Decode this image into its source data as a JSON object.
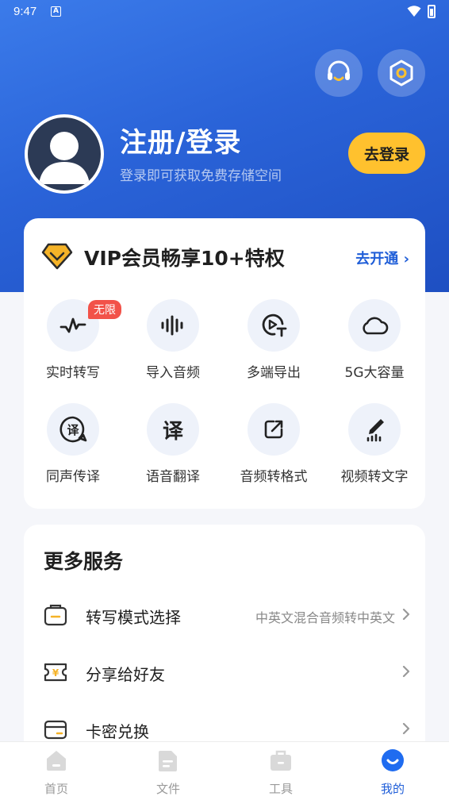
{
  "status_bar": {
    "time": "9:47",
    "notification_icon": "A"
  },
  "header": {
    "support_icon": "headset-icon",
    "settings_icon": "hexagon-settings-icon",
    "login_title": "注册/登录",
    "login_subtitle": "登录即可获取免费存储空间",
    "login_button": "去登录"
  },
  "vip": {
    "title": "VIP会员畅享10+特权",
    "open_label": "去开通",
    "features": [
      {
        "label": "实时转写",
        "icon": "waveform-icon",
        "tag": "无限"
      },
      {
        "label": "导入音频",
        "icon": "audio-bars-icon"
      },
      {
        "label": "多端导出",
        "icon": "export-screen-icon"
      },
      {
        "label": "5G大容量",
        "icon": "cloud-icon"
      },
      {
        "label": "同声传译",
        "icon": "interpret-bubble-icon",
        "glyph": "译"
      },
      {
        "label": "语音翻译",
        "icon": "translate-icon",
        "glyph": "译"
      },
      {
        "label": "音频转格式",
        "icon": "convert-format-icon"
      },
      {
        "label": "视频转文字",
        "icon": "video-to-text-icon"
      }
    ]
  },
  "services": {
    "title": "更多服务",
    "items": [
      {
        "label": "转写模式选择",
        "value": "中英文混合音频转中英文",
        "icon": "mode-select-icon"
      },
      {
        "label": "分享给好友",
        "value": "",
        "icon": "share-ticket-icon"
      },
      {
        "label": "卡密兑换",
        "value": "",
        "icon": "card-icon"
      }
    ]
  },
  "bottom_nav": {
    "items": [
      {
        "label": "首页",
        "icon": "home-icon",
        "active": false
      },
      {
        "label": "文件",
        "icon": "file-icon",
        "active": false
      },
      {
        "label": "工具",
        "icon": "toolbox-icon",
        "active": false
      },
      {
        "label": "我的",
        "icon": "profile-smile-icon",
        "active": true
      }
    ]
  },
  "colors": {
    "brand_blue": "#1f5ed8",
    "hero_gradient": "#3b7bea",
    "login_button": "#ffc12e",
    "tag_red": "#f25249",
    "vip_gold": "#f5b328"
  }
}
